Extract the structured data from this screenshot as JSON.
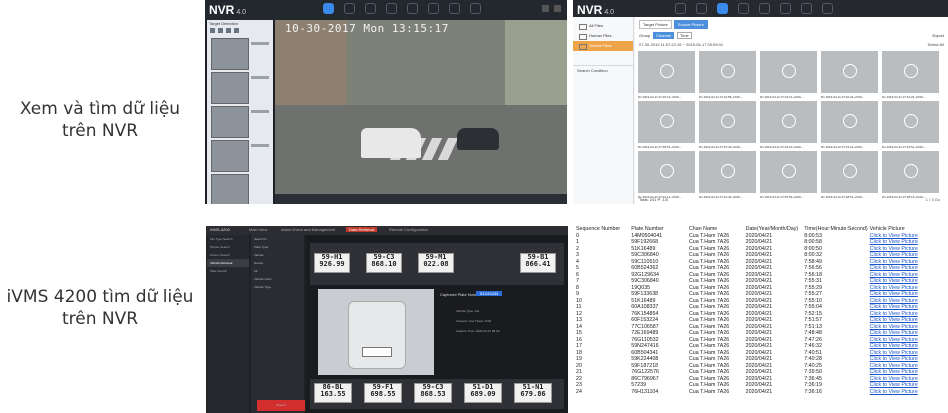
{
  "captions": {
    "top_line1": "Xem và tìm dữ liệu",
    "top_line2": "trên NVR",
    "bottom_line1": "iVMS 4200 tìm dữ liệu",
    "bottom_line2": "trên NVR"
  },
  "nvr_live": {
    "logo": "NVR",
    "logo_version": "4.0",
    "side_title": "Target Detection",
    "osd_time": "10-30-2017 Mon 13:15:17"
  },
  "nvr_files": {
    "logo": "NVR",
    "logo_version": "4.0",
    "side_items": [
      "All Files",
      "Human Files",
      "Vehicle Files"
    ],
    "search_condition": "Search Condition",
    "tabs": [
      "Target Picture",
      "Source Picture"
    ],
    "toolbar": {
      "group": "Group",
      "channel": "Channel",
      "time": "Time",
      "export": "Export"
    },
    "range": "07-30-2019 11:07:22:19 ~ 2019-04-17 09:59:01",
    "select_all": "Select All",
    "tile_names": [
      "D1 2019-04-11 07:22:13~2019-...",
      "D1 2019-04-11 07:22:58~2019-...",
      "D1 2019-04-11 07:24:12~2019-...",
      "D1 2019-04-11 07:40:23~2019-...",
      "D1 2019-04-11 07:44:24~2019-...",
      "D1 2019-04-11 07:48:51~2019-...",
      "D1 2019-04-11 07:43:43~2019-...",
      "D1 2019-04-11 07:43:10~2019-...",
      "D1 2019-04-11 07:43:19~2019-...",
      "D1 2019-04-11 07:43:51~2019-...",
      "D1 2019-04-11 07:42:14~2019-...",
      "D1 2019-04-11 07:44:44~2019-...",
      "D1 2019-04-11 07:45:53~2019-...",
      "D1 2019-04-11 07:48:51~2019-...",
      "D1 2019-04-11 07:48:13~2019-..."
    ],
    "footer": "Total: 241  P: 1/3",
    "pager": "1  /  3     Go"
  },
  "ivms": {
    "title": "iVMS-4200",
    "tabs": [
      "Main View",
      "Alarm Event and Management",
      "Data Retrieval",
      "Remote Configuration"
    ],
    "side_items": [
      "File Type Search",
      "Picture Search",
      "Person Search",
      "Vehicle Retrieval",
      "Plate Search"
    ],
    "filter_items": [
      "Search In",
      "Plate Type",
      "Vehicle",
      "Device",
      "All",
      "Vehicle Color",
      "Vehicle Type"
    ],
    "search_button": "Search",
    "plates_top": [
      "59-H1 926.99",
      "59-C3 868.10",
      "59-M1 022.08",
      "59-B1 866.41"
    ],
    "plates_bottom": [
      "86-BL 163.55",
      "59-F1 698.55",
      "59-C3 868.53",
      "51-D1 689.09",
      "51-N1 679.86"
    ],
    "info_title": "Captured Plate Number",
    "info_button": "51X43434",
    "info_rows": [
      "Vehicle Type: Car",
      "Camera: Cua T.Ham 7A26",
      "Capture Time: 2020-04-21 08:00"
    ]
  },
  "table": {
    "headers": [
      "Sequence Number",
      "Plate Number",
      "Chan Name",
      "Date(Year/Month/Day)",
      "Time(Hour:Minute:Second)",
      "Vehicle Picture"
    ],
    "rows": [
      [
        "0",
        "14M0504041",
        "Cua T.Ham 7A26",
        "2020/04/21",
        "8:00:53",
        "Click to View Picture"
      ],
      [
        "1",
        "59F192668",
        "Cua T.Ham 7A26",
        "2020/04/21",
        "8:00:58",
        "Click to View Picture"
      ],
      [
        "2",
        "51K16489",
        "Cua T.Ham 7A26",
        "2020/04/21",
        "8:00:50",
        "Click to View Picture"
      ],
      [
        "3",
        "59C306840",
        "Cua T.Ham 7A26",
        "2020/04/21",
        "8:00:32",
        "Click to View Picture"
      ],
      [
        "4",
        "59C110510",
        "Cua T.Ham 7A26",
        "2020/04/21",
        "7:58:49",
        "Click to View Picture"
      ],
      [
        "5",
        "60B524362",
        "Cua T.Ham 7A26",
        "2020/04/21",
        "7:56:56",
        "Click to View Picture"
      ],
      [
        "6",
        "92G129634",
        "Cua T.Ham 7A26",
        "2020/04/21",
        "7:56:18",
        "Click to View Picture"
      ],
      [
        "7",
        "59C306840",
        "Cua T.Ham 7A26",
        "2020/04/21",
        "7:55:31",
        "Click to View Picture"
      ],
      [
        "8",
        "19Q035",
        "Cua T.Ham 7A26",
        "2020/04/21",
        "7:55:29",
        "Click to View Picture"
      ],
      [
        "9",
        "59F133638",
        "Cua T.Ham 7A26",
        "2020/04/21",
        "7:55:27",
        "Click to View Picture"
      ],
      [
        "10",
        "51K16489",
        "Cua T.Ham 7A26",
        "2020/04/21",
        "7:55:10",
        "Click to View Picture"
      ],
      [
        "11",
        "60A108337",
        "Cua T.Ham 7A26",
        "2020/04/21",
        "7:55:04",
        "Click to View Picture"
      ],
      [
        "12",
        "76K154854",
        "Cua T.Ham 7A26",
        "2020/04/21",
        "7:52:15",
        "Click to View Picture"
      ],
      [
        "13",
        "60F153224",
        "Cua T.Ham 7A26",
        "2020/04/21",
        "7:51:57",
        "Click to View Picture"
      ],
      [
        "14",
        "77C106587",
        "Cua T.Ham 7A26",
        "2020/04/21",
        "7:51:13",
        "Click to View Picture"
      ],
      [
        "15",
        "72E169489",
        "Cua T.Ham 7A26",
        "2020/04/21",
        "7:48:48",
        "Click to View Picture"
      ],
      [
        "16",
        "76G110532",
        "Cua T.Ham 7A26",
        "2020/04/21",
        "7:47:26",
        "Click to View Picture"
      ],
      [
        "17",
        "59N247416",
        "Cua T.Ham 7A26",
        "2020/04/21",
        "7:46:32",
        "Click to View Picture"
      ],
      [
        "18",
        "60B504341",
        "Cua T.Ham 7A26",
        "2020/04/21",
        "7:40:51",
        "Click to View Picture"
      ],
      [
        "19",
        "59K224408",
        "Cua T.Ham 7A26",
        "2020/04/21",
        "7:40:28",
        "Click to View Picture"
      ],
      [
        "20",
        "59F187218",
        "Cua T.Ham 7A26",
        "2020/04/21",
        "7:40:25",
        "Click to View Picture"
      ],
      [
        "21",
        "76G122576",
        "Cua T.Ham 7A26",
        "2020/04/21",
        "7:39:50",
        "Click to View Picture"
      ],
      [
        "22",
        "86C796967",
        "Cua T.Ham 7A26",
        "2020/04/21",
        "7:36:45",
        "Click to View Picture"
      ],
      [
        "23",
        "57239",
        "Cua T.Ham 7A26",
        "2020/04/21",
        "7:36:19",
        "Click to View Picture"
      ],
      [
        "24",
        "76H131104",
        "Cua T.Ham 7A26",
        "2020/04/21",
        "7:36:16",
        "Click to View Picture"
      ]
    ]
  }
}
